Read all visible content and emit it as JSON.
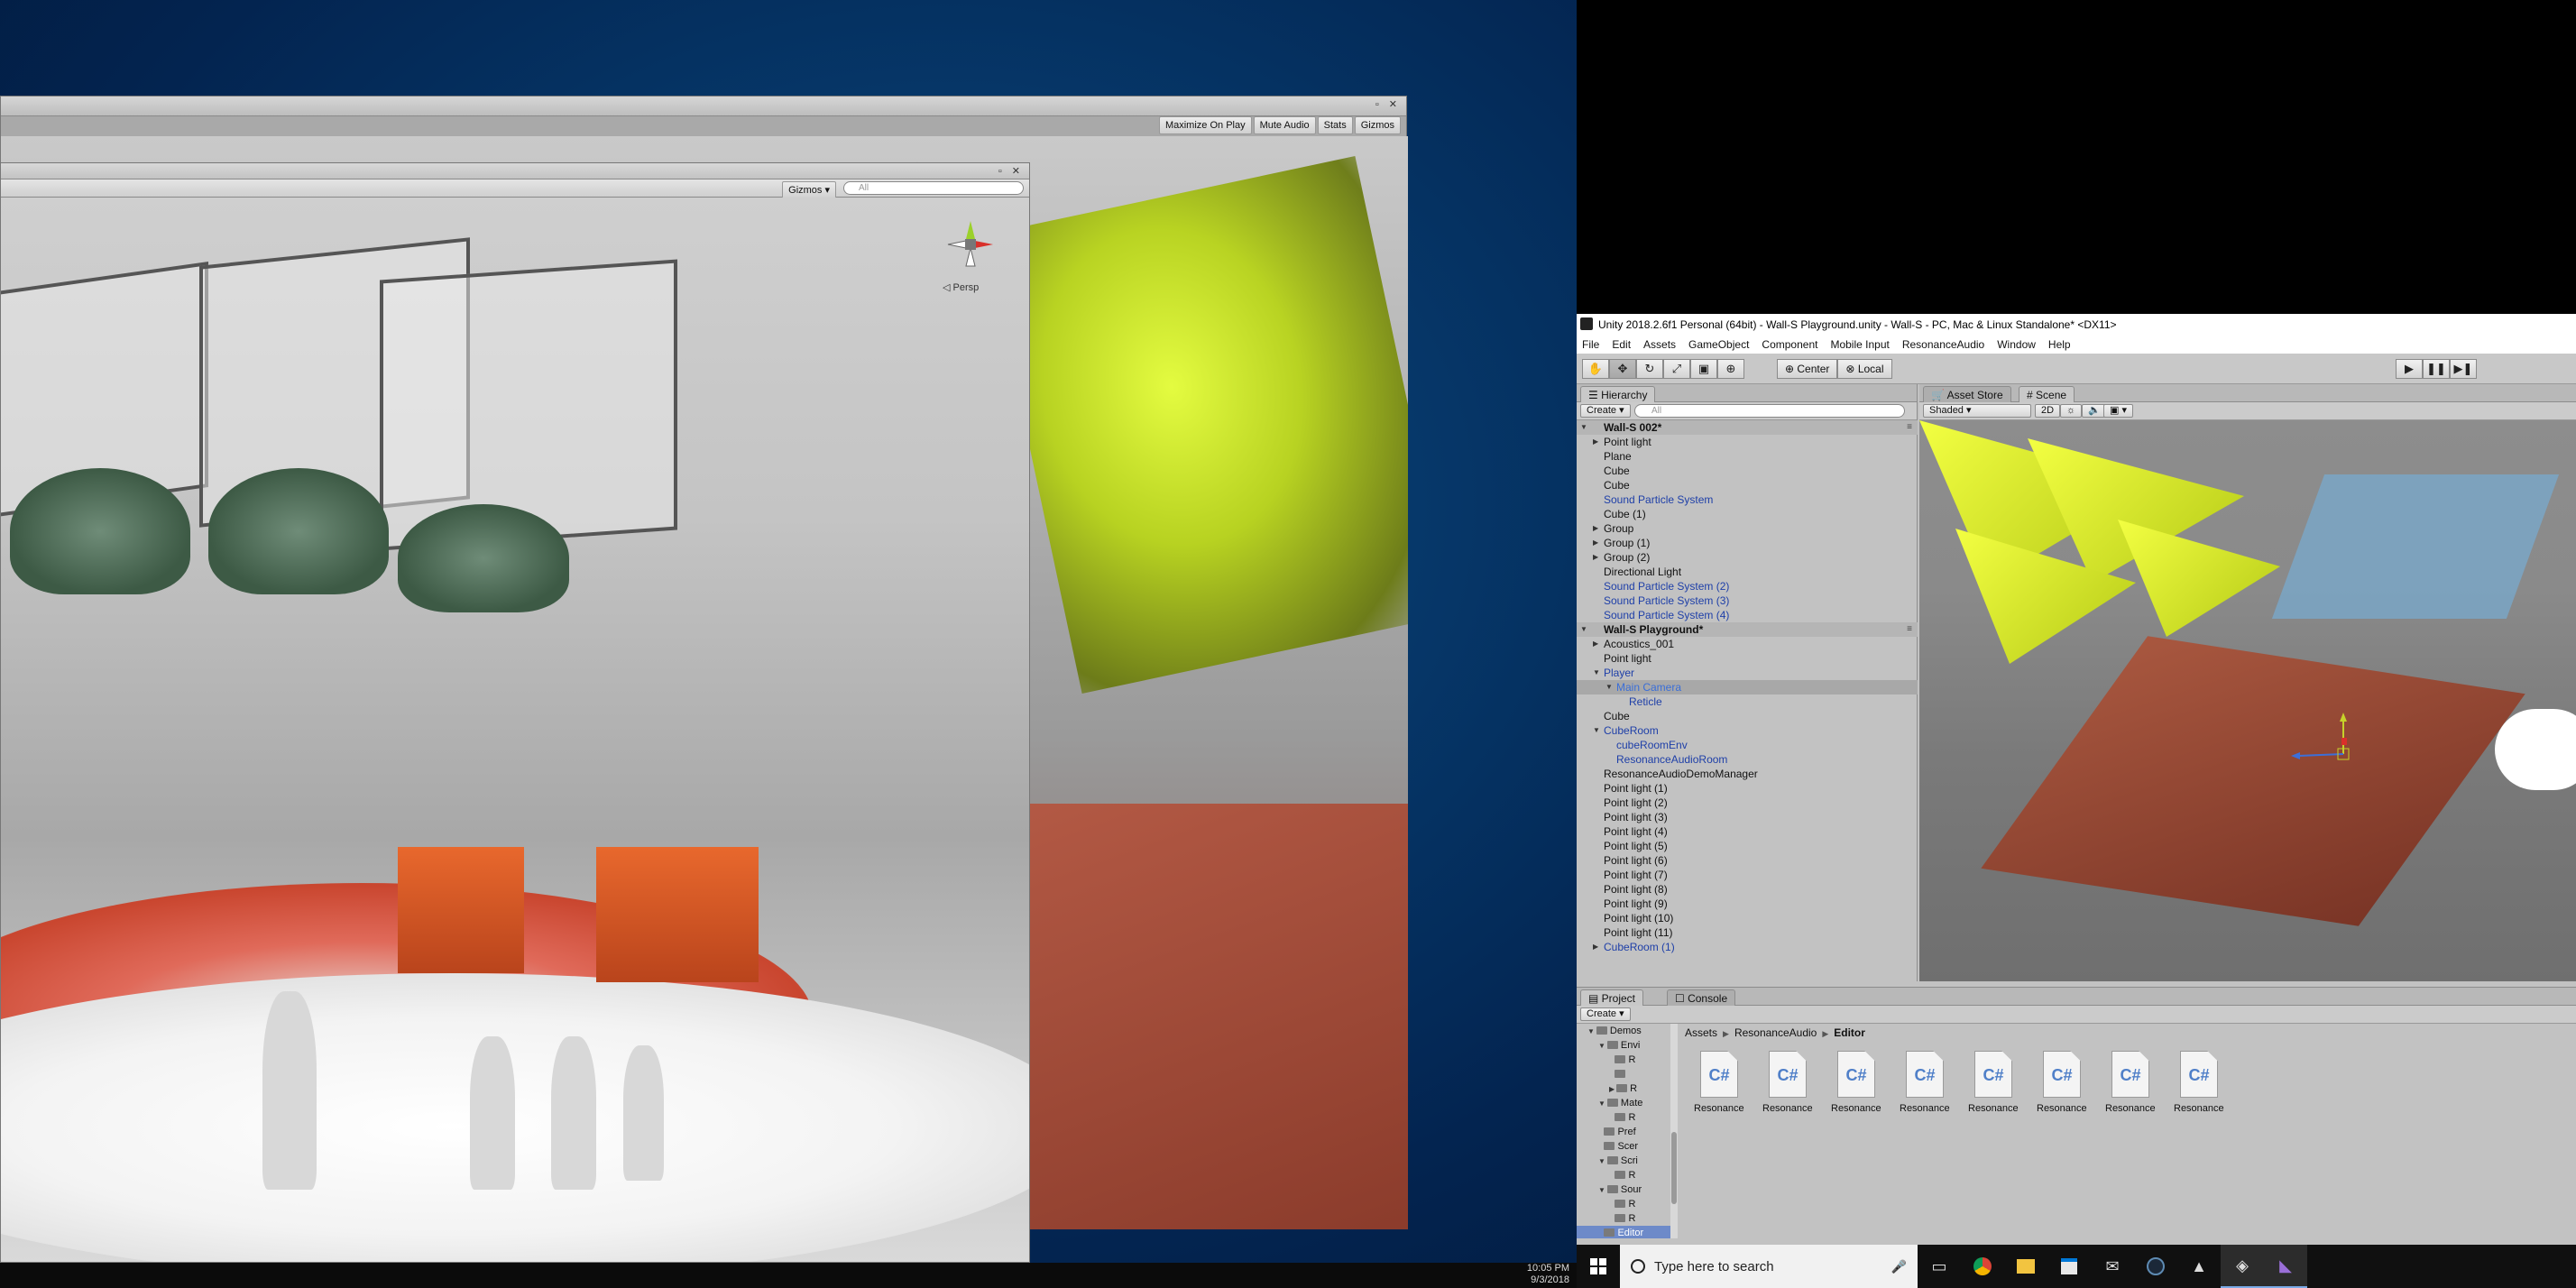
{
  "game_window": {
    "toolbar": [
      "Maximize On Play",
      "Mute Audio",
      "Stats",
      "Gizmos"
    ]
  },
  "scene_window": {
    "gizmos_label": "Gizmos",
    "search_placeholder": "All",
    "persp_label": "Persp"
  },
  "editor": {
    "title": "Unity 2018.2.6f1 Personal (64bit) - Wall-S Playground.unity - Wall-S - PC, Mac & Linux Standalone* <DX11>",
    "menu": [
      "File",
      "Edit",
      "Assets",
      "GameObject",
      "Component",
      "Mobile Input",
      "ResonanceAudio",
      "Window",
      "Help"
    ],
    "toolbar": {
      "pivot_center": "Center",
      "pivot_local": "Local"
    },
    "hierarchy": {
      "tab": "Hierarchy",
      "create_label": "Create",
      "search_placeholder": "All",
      "rows": [
        {
          "text": "Wall-S 002*",
          "kind": "scene",
          "indent": 0,
          "arrow": "▼"
        },
        {
          "text": "Point light",
          "kind": "normal",
          "indent": 1,
          "arrow": "▶"
        },
        {
          "text": "Plane",
          "kind": "normal",
          "indent": 1,
          "arrow": ""
        },
        {
          "text": "Cube",
          "kind": "normal",
          "indent": 1,
          "arrow": ""
        },
        {
          "text": "Cube",
          "kind": "normal",
          "indent": 1,
          "arrow": ""
        },
        {
          "text": "Sound Particle System",
          "kind": "blue",
          "indent": 1,
          "arrow": ""
        },
        {
          "text": "Cube (1)",
          "kind": "normal",
          "indent": 1,
          "arrow": ""
        },
        {
          "text": "Group",
          "kind": "normal",
          "indent": 1,
          "arrow": "▶"
        },
        {
          "text": "Group (1)",
          "kind": "normal",
          "indent": 1,
          "arrow": "▶"
        },
        {
          "text": "Group (2)",
          "kind": "normal",
          "indent": 1,
          "arrow": "▶"
        },
        {
          "text": "Directional Light",
          "kind": "normal",
          "indent": 1,
          "arrow": ""
        },
        {
          "text": "Sound Particle System (2)",
          "kind": "blue",
          "indent": 1,
          "arrow": ""
        },
        {
          "text": "Sound Particle System (3)",
          "kind": "blue",
          "indent": 1,
          "arrow": ""
        },
        {
          "text": "Sound Particle System (4)",
          "kind": "blue",
          "indent": 1,
          "arrow": ""
        },
        {
          "text": "Wall-S Playground*",
          "kind": "scene",
          "indent": 0,
          "arrow": "▼"
        },
        {
          "text": "Acoustics_001",
          "kind": "normal",
          "indent": 1,
          "arrow": "▶"
        },
        {
          "text": "Point light",
          "kind": "normal",
          "indent": 1,
          "arrow": ""
        },
        {
          "text": "Player",
          "kind": "blue",
          "indent": 1,
          "arrow": "▼"
        },
        {
          "text": "Main Camera",
          "kind": "selected",
          "indent": 2,
          "arrow": "▼"
        },
        {
          "text": "Reticle",
          "kind": "blue",
          "indent": 3,
          "arrow": ""
        },
        {
          "text": "Cube",
          "kind": "normal",
          "indent": 1,
          "arrow": ""
        },
        {
          "text": "CubeRoom",
          "kind": "blue",
          "indent": 1,
          "arrow": "▼"
        },
        {
          "text": "cubeRoomEnv",
          "kind": "blue",
          "indent": 2,
          "arrow": ""
        },
        {
          "text": "ResonanceAudioRoom",
          "kind": "blue",
          "indent": 2,
          "arrow": ""
        },
        {
          "text": "ResonanceAudioDemoManager",
          "kind": "normal",
          "indent": 1,
          "arrow": ""
        },
        {
          "text": "Point light (1)",
          "kind": "normal",
          "indent": 1,
          "arrow": ""
        },
        {
          "text": "Point light (2)",
          "kind": "normal",
          "indent": 1,
          "arrow": ""
        },
        {
          "text": "Point light (3)",
          "kind": "normal",
          "indent": 1,
          "arrow": ""
        },
        {
          "text": "Point light (4)",
          "kind": "normal",
          "indent": 1,
          "arrow": ""
        },
        {
          "text": "Point light (5)",
          "kind": "normal",
          "indent": 1,
          "arrow": ""
        },
        {
          "text": "Point light (6)",
          "kind": "normal",
          "indent": 1,
          "arrow": ""
        },
        {
          "text": "Point light (7)",
          "kind": "normal",
          "indent": 1,
          "arrow": ""
        },
        {
          "text": "Point light (8)",
          "kind": "normal",
          "indent": 1,
          "arrow": ""
        },
        {
          "text": "Point light (9)",
          "kind": "normal",
          "indent": 1,
          "arrow": ""
        },
        {
          "text": "Point light (10)",
          "kind": "normal",
          "indent": 1,
          "arrow": ""
        },
        {
          "text": "Point light (11)",
          "kind": "normal",
          "indent": 1,
          "arrow": ""
        },
        {
          "text": "CubeRoom (1)",
          "kind": "blue",
          "indent": 1,
          "arrow": "▶"
        }
      ]
    },
    "scene_panel": {
      "tab_asset_store": "Asset Store",
      "tab_scene": "Scene",
      "shading_mode": "Shaded",
      "toggle_2d": "2D"
    },
    "project": {
      "tab_project": "Project",
      "tab_console": "Console",
      "create_label": "Create",
      "tree": [
        {
          "text": "Demos",
          "indent": 1,
          "tri": "▼"
        },
        {
          "text": "Envi",
          "indent": 2,
          "tri": "▼"
        },
        {
          "text": "R",
          "indent": 3,
          "tri": ""
        },
        {
          "text": "",
          "indent": 3,
          "tri": ""
        },
        {
          "text": "R",
          "indent": 3,
          "tri": "▶"
        },
        {
          "text": "Mate",
          "indent": 2,
          "tri": "▼"
        },
        {
          "text": "R",
          "indent": 3,
          "tri": ""
        },
        {
          "text": "Pref",
          "indent": 2,
          "tri": ""
        },
        {
          "text": "Scer",
          "indent": 2,
          "tri": ""
        },
        {
          "text": "Scri",
          "indent": 2,
          "tri": "▼"
        },
        {
          "text": "R",
          "indent": 3,
          "tri": ""
        },
        {
          "text": "Sour",
          "indent": 2,
          "tri": "▼"
        },
        {
          "text": "R",
          "indent": 3,
          "tri": ""
        },
        {
          "text": "R",
          "indent": 3,
          "tri": ""
        },
        {
          "text": "Editor",
          "indent": 2,
          "tri": "",
          "selected": true
        }
      ],
      "breadcrumb": [
        "Assets",
        "ResonanceAudio",
        "Editor"
      ],
      "file_glyph": "C#",
      "files": [
        "Resonance...",
        "Resonance...",
        "Resonance...",
        "Resonance...",
        "Resonance...",
        "Resonance...",
        "Resonance...",
        "Resonance..."
      ]
    }
  },
  "taskbar": {
    "clock_time": "10:05 PM",
    "clock_date": "9/3/2018",
    "search_placeholder": "Type here to search",
    "apps": [
      "task-view-icon",
      "chrome-icon",
      "file-explorer-icon",
      "store-icon",
      "mail-icon",
      "steam-icon",
      "photos-icon",
      "unity-icon",
      "visual-studio-icon"
    ]
  }
}
